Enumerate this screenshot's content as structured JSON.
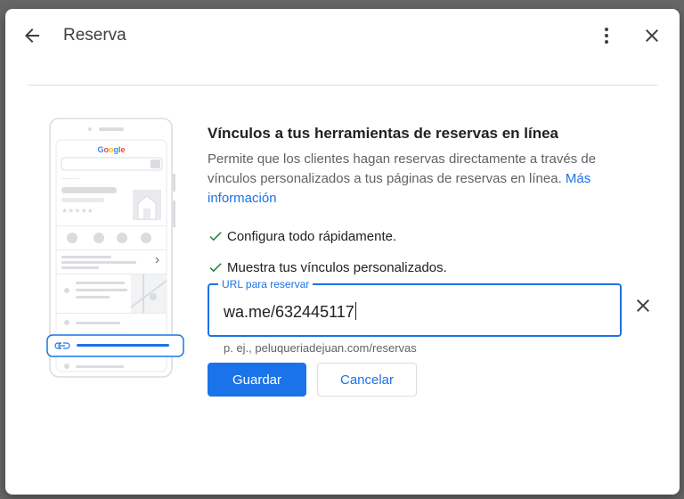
{
  "header": {
    "title": "Reserva",
    "back_icon": "arrow-back-icon",
    "more_icon": "more-vert-icon",
    "close_icon": "close-icon"
  },
  "illustration": {
    "brand": "Google"
  },
  "main": {
    "heading": "Vínculos a tus herramientas de reservas en línea",
    "description": "Permite que los clientes hagan reservas directamente a través de vínculos personalizados a tus páginas de reservas en línea.",
    "more_info_link": "Más información",
    "checks": [
      "Configura todo rápidamente.",
      "Muestra tus vínculos personalizados."
    ]
  },
  "url_field": {
    "label": "URL para reservar",
    "value": "wa.me/632445117",
    "hint": "p. ej., peluqueriadejuan.com/reservas"
  },
  "actions": {
    "save": "Guardar",
    "cancel": "Cancelar"
  },
  "colors": {
    "accent": "#1a73e8",
    "check": "#188038"
  }
}
